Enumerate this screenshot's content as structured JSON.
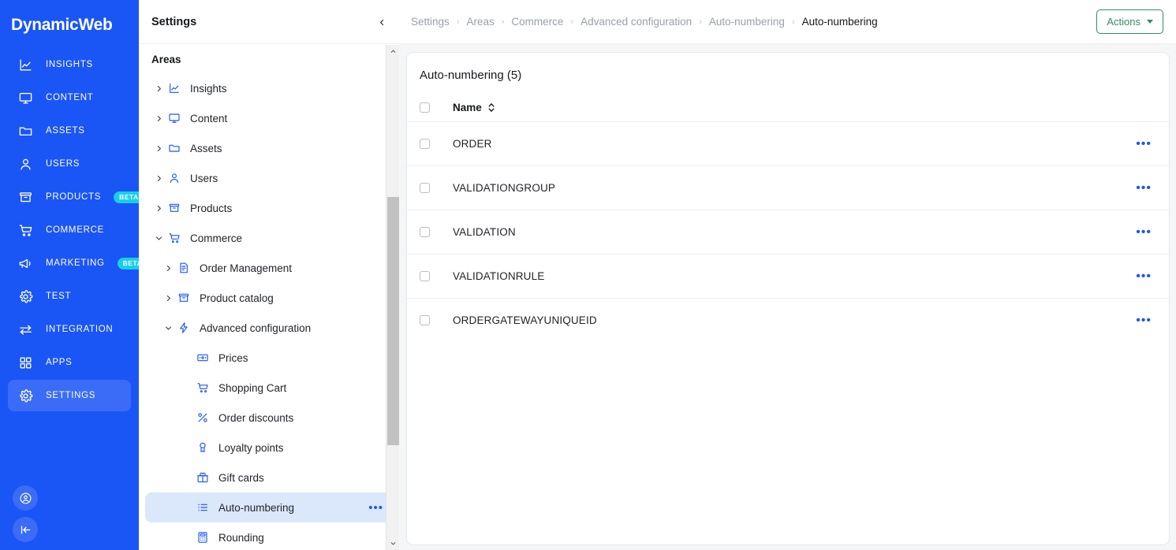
{
  "rail": {
    "brand": "DynamicWeb",
    "items": [
      {
        "label": "INSIGHTS",
        "icon": "chart-line-icon",
        "badge": null,
        "active": false
      },
      {
        "label": "CONTENT",
        "icon": "monitor-icon",
        "badge": null,
        "active": false
      },
      {
        "label": "ASSETS",
        "icon": "folder-icon",
        "badge": null,
        "active": false
      },
      {
        "label": "USERS",
        "icon": "user-icon",
        "badge": null,
        "active": false
      },
      {
        "label": "PRODUCTS",
        "icon": "archive-box-icon",
        "badge": "BETA",
        "active": false
      },
      {
        "label": "COMMERCE",
        "icon": "cart-icon",
        "badge": null,
        "active": false
      },
      {
        "label": "MARKETING",
        "icon": "megaphone-icon",
        "badge": "BETA",
        "active": false
      },
      {
        "label": "TEST",
        "icon": "gear-icon",
        "badge": null,
        "active": false
      },
      {
        "label": "INTEGRATION",
        "icon": "exchange-icon",
        "badge": null,
        "active": false
      },
      {
        "label": "APPS",
        "icon": "grid-icon",
        "badge": null,
        "active": false
      },
      {
        "label": "SETTINGS",
        "icon": "gear-icon",
        "badge": null,
        "active": true
      }
    ],
    "bottom": [
      {
        "icon": "account-circle-icon"
      },
      {
        "icon": "collapse-left-icon"
      }
    ],
    "colors": {
      "bg": "#1a55f5",
      "active": "#3a6cf7",
      "badge": "#18cfe8"
    }
  },
  "tree": {
    "title": "Settings",
    "collapse_icon": "chevron-left-icon",
    "section_label": "Areas",
    "nodes": [
      {
        "label": "Insights",
        "icon": "chart-line-icon",
        "level": 1,
        "twist": "collapsed",
        "selected": false,
        "dots": false
      },
      {
        "label": "Content",
        "icon": "monitor-icon",
        "level": 1,
        "twist": "collapsed",
        "selected": false,
        "dots": false
      },
      {
        "label": "Assets",
        "icon": "folder-icon",
        "level": 1,
        "twist": "collapsed",
        "selected": false,
        "dots": false
      },
      {
        "label": "Users",
        "icon": "user-icon",
        "level": 1,
        "twist": "collapsed",
        "selected": false,
        "dots": false
      },
      {
        "label": "Products",
        "icon": "archive-box-icon",
        "level": 1,
        "twist": "collapsed",
        "selected": false,
        "dots": false
      },
      {
        "label": "Commerce",
        "icon": "cart-icon",
        "level": 1,
        "twist": "expanded",
        "selected": false,
        "dots": false
      },
      {
        "label": "Order Management",
        "icon": "order-list-icon",
        "level": 2,
        "twist": "collapsed",
        "selected": false,
        "dots": false
      },
      {
        "label": "Product catalog",
        "icon": "archive-box-icon",
        "level": 2,
        "twist": "collapsed",
        "selected": false,
        "dots": false
      },
      {
        "label": "Advanced configuration",
        "icon": "lightning-icon",
        "level": 2,
        "twist": "expanded",
        "selected": false,
        "dots": false
      },
      {
        "label": "Prices",
        "icon": "price-tag-icon",
        "level": 3,
        "twist": "none",
        "selected": false,
        "dots": false
      },
      {
        "label": "Shopping Cart",
        "icon": "cart-icon",
        "level": 3,
        "twist": "none",
        "selected": false,
        "dots": false
      },
      {
        "label": "Order discounts",
        "icon": "percent-icon",
        "level": 3,
        "twist": "none",
        "selected": false,
        "dots": false
      },
      {
        "label": "Loyalty points",
        "icon": "medal-icon",
        "level": 3,
        "twist": "none",
        "selected": false,
        "dots": false
      },
      {
        "label": "Gift cards",
        "icon": "gift-icon",
        "level": 3,
        "twist": "none",
        "selected": false,
        "dots": false
      },
      {
        "label": "Auto-numbering",
        "icon": "list-icon",
        "level": 3,
        "twist": "none",
        "selected": true,
        "dots": true
      },
      {
        "label": "Rounding",
        "icon": "calculator-icon",
        "level": 3,
        "twist": "none",
        "selected": false,
        "dots": false
      }
    ],
    "scrollbar": {
      "up_icon": "chevron-up-icon",
      "down_icon": "chevron-down-icon"
    }
  },
  "topbar": {
    "breadcrumbs": [
      "Settings",
      "Areas",
      "Commerce",
      "Advanced configuration",
      "Auto-numbering",
      "Auto-numbering"
    ],
    "separator": "›",
    "actions_label": "Actions",
    "actions_color": "#2f8f63"
  },
  "table": {
    "card_title": "Auto-numbering (5)",
    "columns": [
      "Name"
    ],
    "sort_icon": "sort-updown-icon",
    "row_menu_icon": "ellipsis-icon",
    "rows": [
      {
        "name": "ORDER"
      },
      {
        "name": "VALIDATIONGROUP"
      },
      {
        "name": "VALIDATION"
      },
      {
        "name": "VALIDATIONRULE"
      },
      {
        "name": "ORDERGATEWAYUNIQUEID"
      }
    ]
  }
}
